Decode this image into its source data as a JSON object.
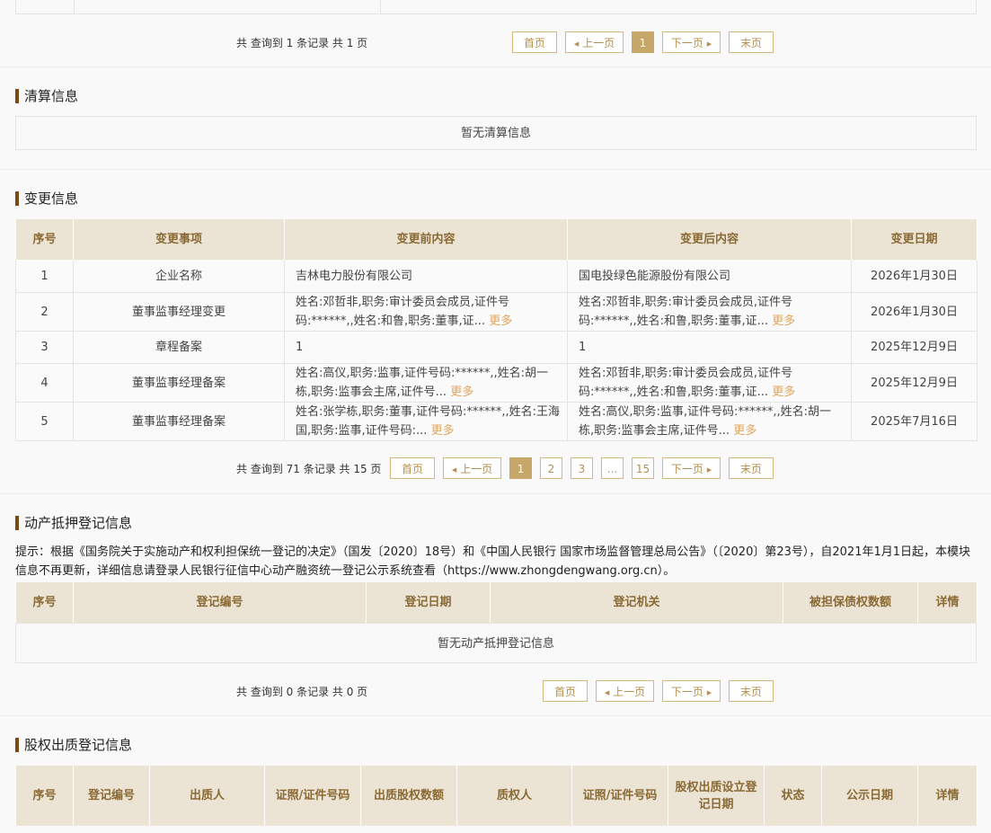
{
  "top_pagination": {
    "count_text": "共 查询到 1 条记录 共 1 页",
    "first": "首页",
    "prev": "上一页",
    "pages": [
      "1"
    ],
    "next": "下一页",
    "last": "末页"
  },
  "liquidation": {
    "title": "清算信息",
    "empty": "暂无清算信息"
  },
  "changes": {
    "title": "变更信息",
    "headers": [
      "序号",
      "变更事项",
      "变更前内容",
      "变更后内容",
      "变更日期"
    ],
    "more_label": "更多",
    "rows": [
      {
        "no": "1",
        "item": "企业名称",
        "before": "吉林电力股份有限公司",
        "after": "国电投绿色能源股份有限公司",
        "date": "2026年1月30日"
      },
      {
        "no": "2",
        "item": "董事监事经理变更",
        "before": "姓名:邓哲非,职务:审计委员会成员,证件号码:******,,姓名:和鲁,职务:董事,证...",
        "after": "姓名:邓哲非,职务:审计委员会成员,证件号码:******,,姓名:和鲁,职务:董事,证...",
        "date": "2026年1月30日"
      },
      {
        "no": "3",
        "item": "章程备案",
        "before": "1",
        "after": "1",
        "date": "2025年12月9日"
      },
      {
        "no": "4",
        "item": "董事监事经理备案",
        "before": "姓名:高仪,职务:监事,证件号码:******,,姓名:胡一栋,职务:监事会主席,证件号...",
        "after": "姓名:邓哲非,职务:审计委员会成员,证件号码:******,,姓名:和鲁,职务:董事,证...",
        "date": "2025年12月9日"
      },
      {
        "no": "5",
        "item": "董事监事经理备案",
        "before": "姓名:张学栋,职务:董事,证件号码:******,,姓名:王海国,职务:监事,证件号码:...",
        "after": "姓名:高仪,职务:监事,证件号码:******,,姓名:胡一栋,职务:监事会主席,证件号...",
        "date": "2025年7月16日"
      }
    ],
    "pagination": {
      "count_text": "共 查询到 71 条记录 共 15 页",
      "first": "首页",
      "prev": "上一页",
      "pages": [
        "1",
        "2",
        "3",
        "...",
        "15"
      ],
      "next": "下一页",
      "last": "末页"
    }
  },
  "chattel": {
    "title": "动产抵押登记信息",
    "notice": "提示：根据《国务院关于实施动产和权利担保统一登记的决定》（国发〔2020〕18号）和《中国人民银行 国家市场监督管理总局公告》（〔2020〕第23号），自2021年1月1日起，本模块信息不再更新，详细信息请登录人民银行征信中心动产融资统一登记公示系统查看（https://www.zhongdengwang.org.cn）。",
    "headers": [
      "序号",
      "登记编号",
      "登记日期",
      "登记机关",
      "被担保债权数额",
      "详情"
    ],
    "empty": "暂无动产抵押登记信息",
    "pagination": {
      "count_text": "共 查询到 0 条记录 共 0 页",
      "first": "首页",
      "prev": "上一页",
      "next": "下一页",
      "last": "末页"
    }
  },
  "equity": {
    "title": "股权出质登记信息",
    "headers": [
      "序号",
      "登记编号",
      "出质人",
      "证照/证件号码",
      "出质股权数额",
      "质权人",
      "证照/证件号码",
      "股权出质设立登记日期",
      "状态",
      "公示日期",
      "详情"
    ]
  }
}
